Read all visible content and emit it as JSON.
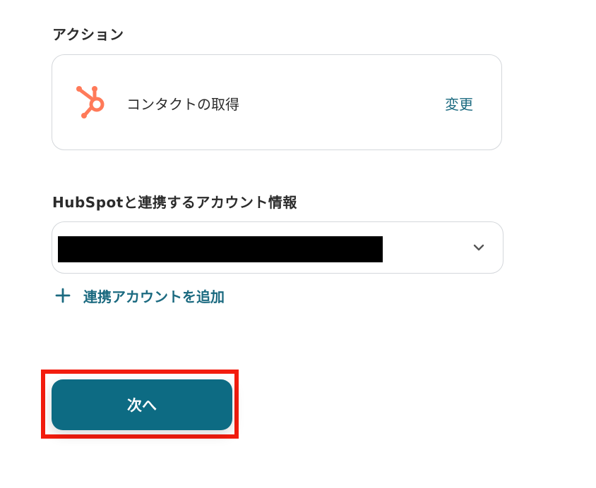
{
  "action_section": {
    "label": "アクション",
    "card": {
      "app_icon": "hubspot-icon",
      "action_name": "コンタクトの取得",
      "change_label": "変更"
    }
  },
  "account_section": {
    "label": "HubSpotと連携するアカウント情報",
    "selected_account": "",
    "dropdown_icon": "chevron-down-icon"
  },
  "add_account": {
    "icon": "plus-icon",
    "label": "連携アカウントを追加"
  },
  "next_button": {
    "label": "次へ"
  },
  "colors": {
    "accent": "#1b6a80",
    "button_bg": "#0d6b83",
    "hubspot_orange": "#ff7a59",
    "highlight": "#f31c0e",
    "border": "#d4d7db"
  }
}
